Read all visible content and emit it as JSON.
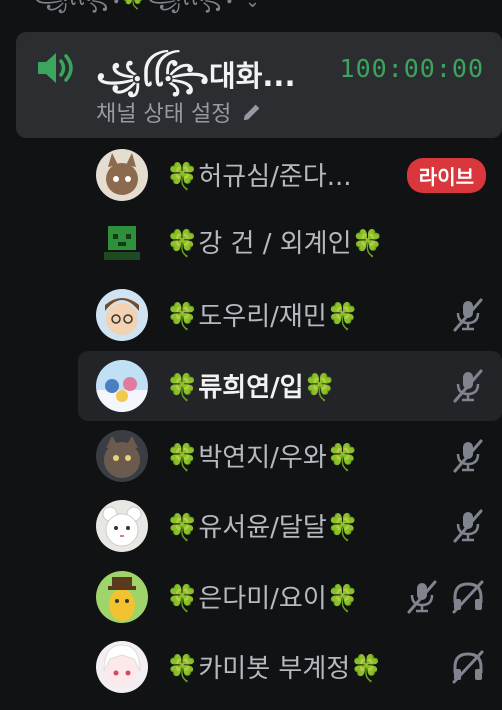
{
  "category": {
    "label": "꧁ꪶꪶ꧂🍀꧁ꪶꪶ꧂",
    "chevron_icon": "chevron-down-icon"
  },
  "voice_channel": {
    "name": "꧁ꪶꪶ꧂대화...",
    "timer": "100:00:00",
    "status_label": "채널 상태 설정",
    "speaker_icon": "speaker-icon",
    "edit_icon": "pencil-icon",
    "accent_color": "#3ba55d"
  },
  "members": [
    {
      "name": "🍀허규심/준다...",
      "badge": "라이브",
      "muted": false,
      "deafened": false,
      "selected": false
    },
    {
      "name": "🍀강 건 / 외계인🍀",
      "badge": "",
      "muted": false,
      "deafened": false,
      "selected": false
    },
    {
      "name": "🍀도우리/재민🍀",
      "badge": "",
      "muted": true,
      "deafened": false,
      "selected": false
    },
    {
      "name": "🍀류희연/입🍀",
      "badge": "",
      "muted": true,
      "deafened": false,
      "selected": true
    },
    {
      "name": "🍀박연지/우와🍀",
      "badge": "",
      "muted": true,
      "deafened": false,
      "selected": false
    },
    {
      "name": "🍀유서윤/달달🍀",
      "badge": "",
      "muted": true,
      "deafened": false,
      "selected": false
    },
    {
      "name": "🍀은다미/요이🍀",
      "badge": "",
      "muted": true,
      "deafened": true,
      "selected": false
    },
    {
      "name": "🍀카미봇 부계정🍀",
      "badge": "",
      "muted": false,
      "deafened": true,
      "selected": false
    }
  ],
  "colors": {
    "background": "#111214",
    "selected_row": "#232428",
    "live_badge": "#da373c",
    "status_icon": "#80848e"
  }
}
